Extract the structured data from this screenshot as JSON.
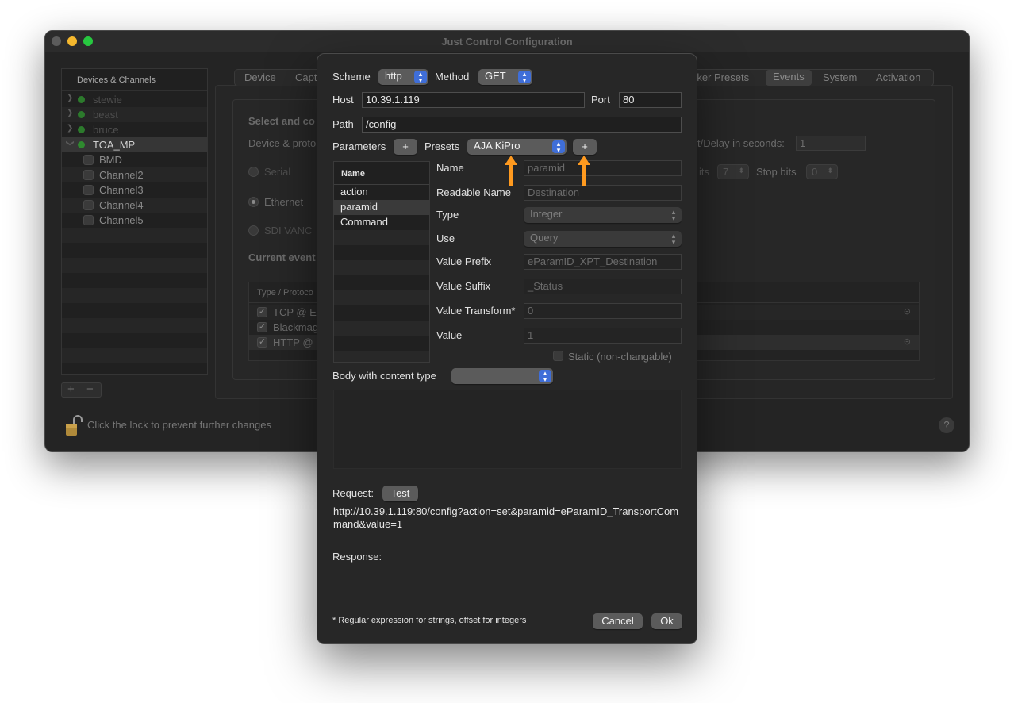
{
  "window": {
    "title": "Just Control Configuration"
  },
  "sidebar": {
    "header": "Devices & Channels",
    "devices": [
      {
        "label": "stewie",
        "enabled": false
      },
      {
        "label": "beast",
        "enabled": false
      },
      {
        "label": "bruce",
        "enabled": false
      },
      {
        "label": "TOA_MP",
        "enabled": true
      }
    ],
    "channels": [
      "BMD",
      "Channel2",
      "Channel3",
      "Channel4",
      "Channel5"
    ],
    "add_label": "+",
    "remove_label": "−"
  },
  "footer": {
    "lock_text": "Click the lock to prevent further changes",
    "help_label": "?"
  },
  "tabs": [
    {
      "label": "Device"
    },
    {
      "label": "Capt"
    },
    {
      "label": "rker Presets"
    },
    {
      "label": "Events",
      "selected": true
    },
    {
      "label": "System"
    },
    {
      "label": "Activation"
    }
  ],
  "background": {
    "select_heading": "Select and co",
    "device_proto_label": "Device & proto",
    "delay_label": "t/Delay in seconds:",
    "delay_value": "1",
    "serial_label": "Serial",
    "bits_label": "its",
    "bits_value": "7",
    "stopbits_label": "Stop bits",
    "stopbits_value": "0",
    "ethernet_label": "Ethernet",
    "sdi_label": "SDI VANC",
    "current_events_label": "Current event",
    "table_header": "Type / Protoco",
    "events": [
      {
        "label": "TCP @ Et",
        "checked": true
      },
      {
        "label": "Blackmag",
        "checked": true
      },
      {
        "label": "HTTP @ I",
        "checked": true
      }
    ]
  },
  "dialog": {
    "scheme_label": "Scheme",
    "scheme_value": "http",
    "method_label": "Method",
    "method_value": "GET",
    "host_label": "Host",
    "host_value": "10.39.1.119",
    "port_label": "Port",
    "port_value": "80",
    "path_label": "Path",
    "path_value": "/config",
    "parameters_label": "Parameters",
    "add_param_label": "+",
    "presets_label": "Presets",
    "preset_value": "AJA KiPro",
    "add_preset_label": "+",
    "params_header": "Name",
    "params": [
      "action",
      "paramid",
      "Command"
    ],
    "selected_param": "paramid",
    "detail": {
      "name_label": "Name",
      "name_value": "paramid",
      "readable_label": "Readable Name",
      "readable_value": "Destination",
      "type_label": "Type",
      "type_value": "Integer",
      "use_label": "Use",
      "use_value": "Query",
      "prefix_label": "Value Prefix",
      "prefix_value": "eParamID_XPT_Destination",
      "suffix_label": "Value Suffix",
      "suffix_value": "_Status",
      "transform_label": "Value Transform*",
      "transform_value": "0",
      "value_label": "Value",
      "value_value": "1",
      "static_label": "Static (non-changable)"
    },
    "body_label": "Body with content type",
    "body_type_value": "",
    "request_label": "Request:",
    "test_label": "Test",
    "request_url": "http://10.39.1.119:80/config?action=set&paramid=eParamID_TransportCommand&value=1",
    "response_label": "Response:",
    "footnote": "* Regular expression for strings, offset for integers",
    "cancel_label": "Cancel",
    "ok_label": "Ok"
  },
  "annotations": {
    "arrow_color": "#ff9a1f"
  }
}
